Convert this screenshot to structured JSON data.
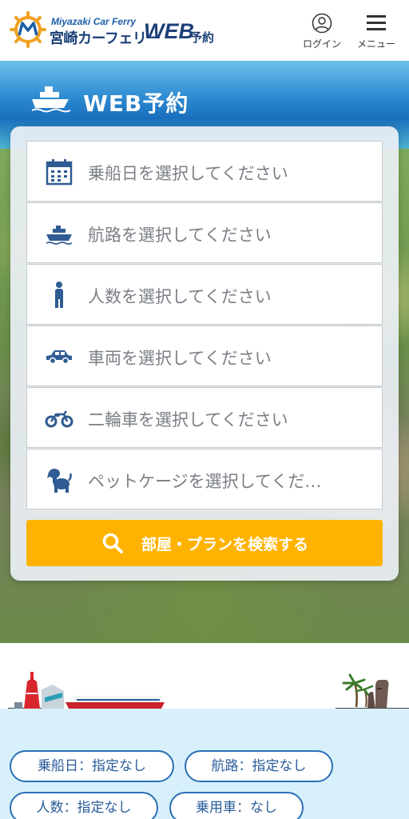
{
  "header": {
    "brand_en": "Miyazaki Car Ferry",
    "brand_ja": "宮崎カーフェリー",
    "brand_web": "WEB",
    "brand_yoyaku": "予約",
    "login_label": "ログイン",
    "menu_label": "メニュー",
    "logo_color": "#f0a020",
    "brand_color": "#1b3f78"
  },
  "hero": {
    "title": "WEB予約",
    "fields": [
      {
        "icon": "calendar-icon",
        "placeholder": "乗船日を選択してください"
      },
      {
        "icon": "ship-icon",
        "placeholder": "航路を選択してください"
      },
      {
        "icon": "person-icon",
        "placeholder": "人数を選択してください"
      },
      {
        "icon": "car-icon",
        "placeholder": "車両を選択してください"
      },
      {
        "icon": "motorcycle-icon",
        "placeholder": "二輪車を選択してください"
      },
      {
        "icon": "dog-icon",
        "placeholder": "ペットケージを選択してくだ…"
      }
    ],
    "search_label": "部屋・プランを検索する",
    "search_color": "#ffb300",
    "icon_color": "#2f5c92"
  },
  "conditions": {
    "chips": [
      "乗船日：指定なし",
      "航路：指定なし",
      "人数：指定なし",
      "乗用車：なし"
    ]
  }
}
